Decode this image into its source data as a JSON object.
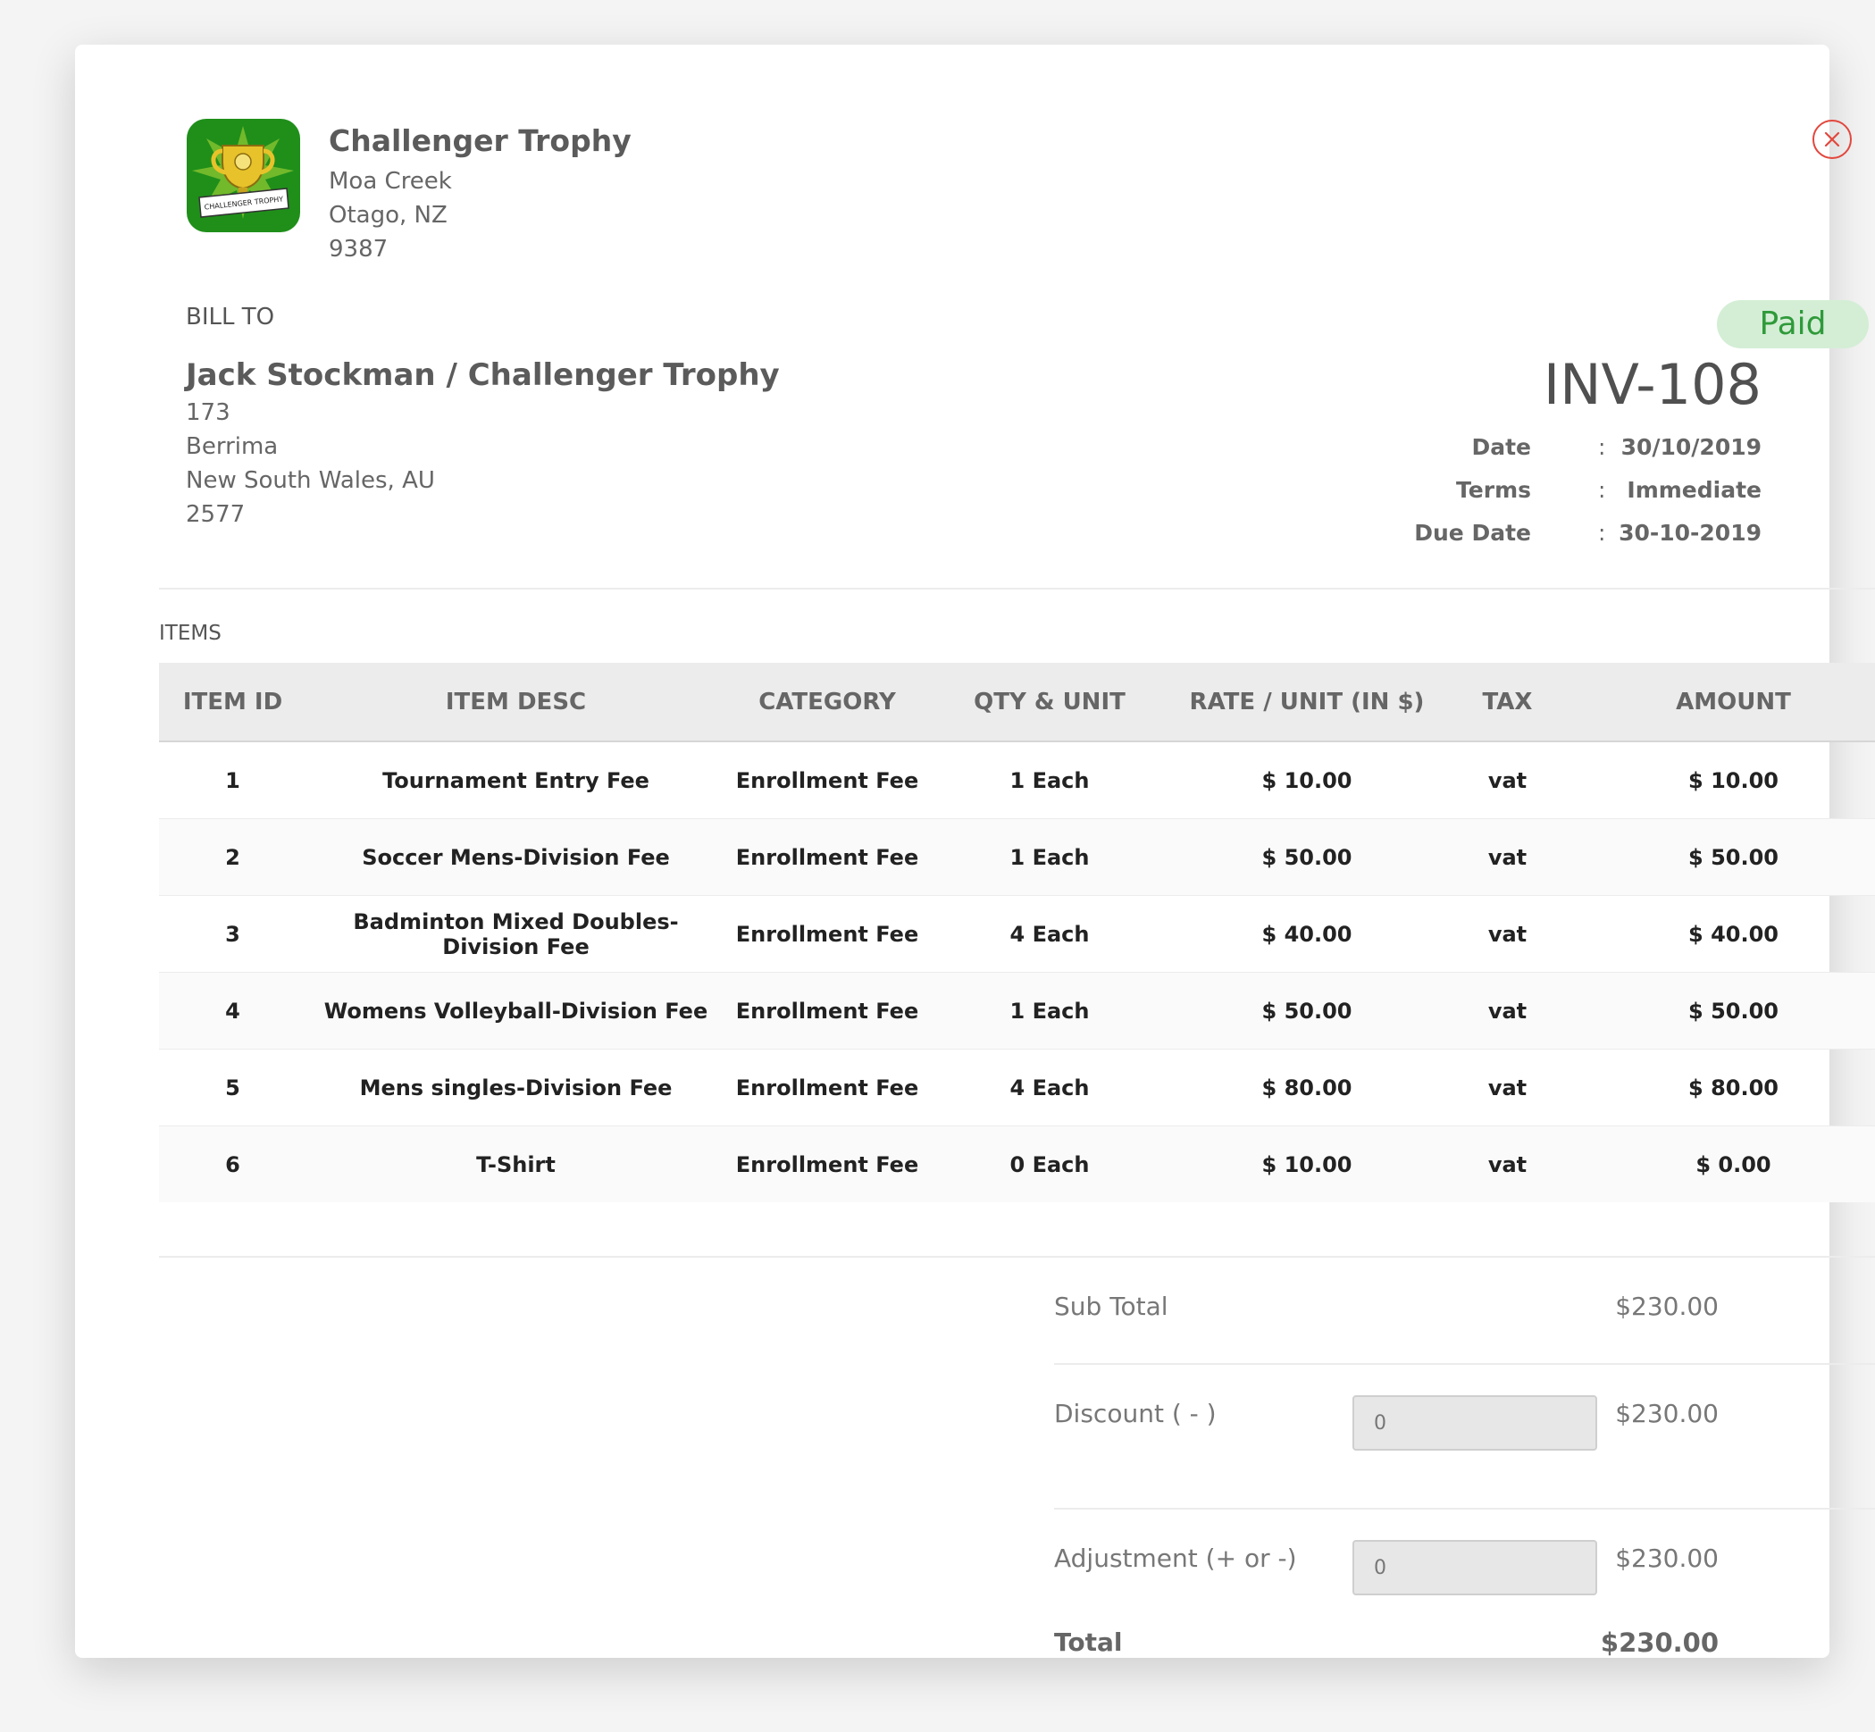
{
  "organization": {
    "name": "Challenger Trophy",
    "address": [
      "Moa Creek",
      "Otago, NZ",
      "9387"
    ],
    "logo_banner_text": "CHALLENGER TROPHY"
  },
  "bill_to": {
    "heading": "BILL TO",
    "name": "Jack Stockman / Challenger Trophy",
    "address": [
      "173",
      "Berrima",
      "New South Wales, AU",
      "2577"
    ]
  },
  "invoice": {
    "status": "Paid",
    "number": "INV-108",
    "meta": [
      {
        "label": "Date",
        "value": "30/10/2019"
      },
      {
        "label": "Terms",
        "value": "Immediate"
      },
      {
        "label": "Due Date",
        "value": "30-10-2019"
      }
    ],
    "meta_separator": ":"
  },
  "items": {
    "heading": "ITEMS",
    "columns": [
      "ITEM ID",
      "ITEM DESC",
      "CATEGORY",
      "QTY & UNIT",
      "RATE / UNIT (IN $)",
      "TAX",
      "AMOUNT"
    ],
    "rows": [
      [
        "1",
        "Tournament Entry Fee",
        "Enrollment Fee",
        "1 Each",
        "$ 10.00",
        "vat",
        "$ 10.00"
      ],
      [
        "2",
        "Soccer Mens-Division Fee",
        "Enrollment Fee",
        "1 Each",
        "$ 50.00",
        "vat",
        "$ 50.00"
      ],
      [
        "3",
        "Badminton Mixed Doubles-Division Fee",
        "Enrollment Fee",
        "4 Each",
        "$ 40.00",
        "vat",
        "$ 40.00"
      ],
      [
        "4",
        "Womens Volleyball-Division Fee",
        "Enrollment Fee",
        "1 Each",
        "$ 50.00",
        "vat",
        "$ 50.00"
      ],
      [
        "5",
        "Mens singles-Division Fee",
        "Enrollment Fee",
        "4 Each",
        "$ 80.00",
        "vat",
        "$ 80.00"
      ],
      [
        "6",
        "T-Shirt",
        "Enrollment Fee",
        "0 Each",
        "$ 10.00",
        "vat",
        "$ 0.00"
      ]
    ]
  },
  "summary": {
    "subtotal_label": "Sub Total",
    "subtotal_value": "$230.00",
    "discount_label": "Discount ( - )",
    "discount_input": "0",
    "discount_value": "$230.00",
    "adjustment_label": "Adjustment (+ or -)",
    "adjustment_input": "0",
    "adjustment_value": "$230.00",
    "total_label": "Total",
    "total_value": "$230.00"
  },
  "colors": {
    "paid_badge_bg": "#d4eed6",
    "paid_badge_text": "#2f9a3a",
    "close_icon": "#e2473d",
    "logo_bg": "#1f8f1a",
    "trophy_gold": "#e8c22a"
  },
  "icons": {
    "close": "close-icon",
    "logo": "trophy-logo-icon"
  }
}
